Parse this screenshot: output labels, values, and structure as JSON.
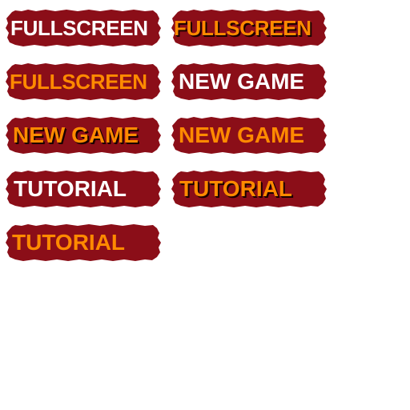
{
  "colors": {
    "button_bg": "#8b0e18",
    "text_white": "#ffffff",
    "text_orange": "#ff8a00",
    "text_shadow": "#1a0000"
  },
  "buttons": [
    {
      "label": "FULLSCREEN",
      "state": "normal"
    },
    {
      "label": "FULLSCREEN",
      "state": "pressed"
    },
    {
      "label": "FULLSCREEN",
      "state": "hover"
    },
    {
      "label": "NEW GAME",
      "state": "normal"
    },
    {
      "label": "NEW GAME",
      "state": "pressed"
    },
    {
      "label": "NEW GAME",
      "state": "hover"
    },
    {
      "label": "TUTORIAL",
      "state": "normal"
    },
    {
      "label": "TUTORIAL",
      "state": "pressed"
    },
    {
      "label": "TUTORIAL",
      "state": "hover"
    }
  ]
}
